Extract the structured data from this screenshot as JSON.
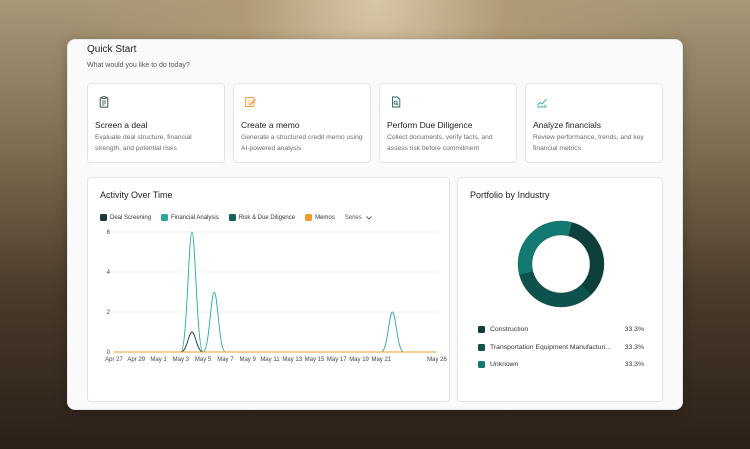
{
  "quick_start": {
    "title": "Quick Start",
    "subtitle": "What would you like to do today?",
    "cards": [
      {
        "icon": "clipboard-icon",
        "title": "Screen a deal",
        "desc": "Evaluate deal structure, financial strength, and potential risks"
      },
      {
        "icon": "edit-memo-icon",
        "title": "Create a memo",
        "desc": "Generate a structured credit memo using AI-powered analysis"
      },
      {
        "icon": "document-search-icon",
        "title": "Perform Due Diligence",
        "desc": "Collect documents, verify facts, and assess risk before commitment"
      },
      {
        "icon": "line-chart-icon",
        "title": "Analyze financials",
        "desc": "Review performance, trends, and key financial metrics"
      }
    ]
  },
  "activity": {
    "title": "Activity Over Time",
    "series_button": "Series",
    "legend": [
      {
        "name": "Deal Screening",
        "color": "#1f3a36"
      },
      {
        "name": "Financial Analysis",
        "color": "#2aa9a3"
      },
      {
        "name": "Risk & Due Diligence",
        "color": "#14625d"
      },
      {
        "name": "Memos",
        "color": "#f29a2e"
      }
    ]
  },
  "chart_data": [
    {
      "type": "line",
      "x": [
        "Apr 27",
        "Apr 29",
        "May 1",
        "May 3",
        "May 5",
        "May 7",
        "May 9",
        "May 11",
        "May 13",
        "May 15",
        "May 17",
        "May 19",
        "May 21",
        "May 26"
      ],
      "ylim": [
        0,
        6
      ],
      "yticks": [
        "0",
        "2",
        "4",
        "6"
      ],
      "grid": true,
      "series": [
        {
          "name": "Deal Screening",
          "color": "#1f3a36",
          "points": [
            [
              "May 4",
              1
            ]
          ]
        },
        {
          "name": "Financial Analysis",
          "color": "#2aa9a3",
          "points": [
            [
              "May 4",
              6
            ],
            [
              "May 6",
              3
            ],
            [
              "May 22",
              2
            ]
          ]
        },
        {
          "name": "Risk & Due Diligence",
          "color": "#14625d",
          "points": []
        },
        {
          "name": "Memos",
          "color": "#f29a2e",
          "points": []
        }
      ]
    },
    {
      "type": "pie",
      "categories": [
        "Construction",
        "Transportation Equipment Manufacturi...",
        "Unknown"
      ],
      "values": [
        33.3,
        33.3,
        33.3
      ],
      "colors": [
        "#0d3f3b",
        "#0f524d",
        "#127a72"
      ]
    }
  ],
  "portfolio": {
    "title": "Portfolio by Industry",
    "items": [
      {
        "label": "Construction",
        "pct": "33.3%",
        "color": "#0d3f3b"
      },
      {
        "label": "Transportation Equipment Manufacturi...",
        "pct": "33.3%",
        "color": "#0f524d"
      },
      {
        "label": "Unknown",
        "pct": "33.3%",
        "color": "#127a72"
      }
    ]
  }
}
